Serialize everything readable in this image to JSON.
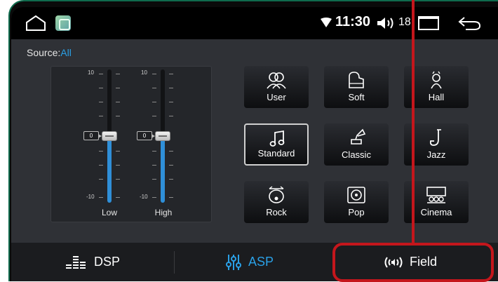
{
  "status": {
    "time": "11:30",
    "volume": "18",
    "icons": [
      "home-icon",
      "app-icon",
      "wifi-icon",
      "speaker-icon",
      "recent-apps-icon",
      "back-icon"
    ]
  },
  "source": {
    "label": "Source:",
    "value": "All"
  },
  "equalizer": {
    "bands": [
      {
        "name": "Low",
        "value": "0",
        "max": "10",
        "min": "-10"
      },
      {
        "name": "High",
        "value": "0",
        "max": "10",
        "min": "-10"
      }
    ]
  },
  "presets": [
    {
      "label": "User",
      "icon": "user-group-icon",
      "selected": false
    },
    {
      "label": "Soft",
      "icon": "piano-icon",
      "selected": false
    },
    {
      "label": "Hall",
      "icon": "hall-icon",
      "selected": false
    },
    {
      "label": "Standard",
      "icon": "music-note-icon",
      "selected": true
    },
    {
      "label": "Classic",
      "icon": "gramophone-icon",
      "selected": false
    },
    {
      "label": "Jazz",
      "icon": "saxophone-icon",
      "selected": false
    },
    {
      "label": "Rock",
      "icon": "drum-icon",
      "selected": false
    },
    {
      "label": "Pop",
      "icon": "vinyl-icon",
      "selected": false
    },
    {
      "label": "Cinema",
      "icon": "cinema-icon",
      "selected": false
    }
  ],
  "tabs": [
    {
      "label": "DSP",
      "icon": "equalizer-bars-icon",
      "active": false
    },
    {
      "label": "ASP",
      "icon": "sliders-icon",
      "active": true
    },
    {
      "label": "Field",
      "icon": "sound-field-icon",
      "active": false
    }
  ],
  "colors": {
    "accent": "#2aa0e6",
    "highlight": "#c4161c",
    "background": "#2f3136"
  }
}
